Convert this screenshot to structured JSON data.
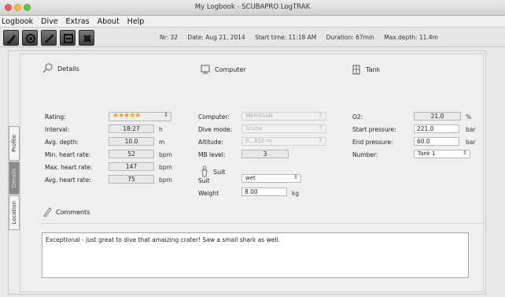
{
  "window": {
    "title": "My Logbook - SCUBAPRO LogTRAK"
  },
  "menu": {
    "items": [
      "Logbook",
      "Dive",
      "Extras",
      "About",
      "Help"
    ]
  },
  "toolbar": {
    "buttons": [
      "logbook-icon",
      "dive-computer-icon",
      "edit-icon",
      "download-icon",
      "settings-icon"
    ],
    "dive_info": {
      "nr": "Nr: 32",
      "date": "Date: Aug 21, 2014",
      "start": "Start time: 11:18 AM",
      "duration": "Duration: 67min",
      "maxdepth": "Max.depth: 11.4m"
    }
  },
  "side_tabs": {
    "profile": "Profile",
    "details": "Details",
    "location": "Location",
    "active": "details"
  },
  "details": {
    "header": "Details",
    "rating_label": "Rating:",
    "rating": {
      "value": 5,
      "max": 5,
      "stars": "★★★★★"
    },
    "interval_label": "Interval:",
    "interval_value": "18:27",
    "interval_unit": "h",
    "avgdepth_label": "Avg. depth:",
    "avgdepth_value": "10.0",
    "avgdepth_unit": "m",
    "minhr_label": "Min. heart rate:",
    "minhr_value": "52",
    "minhr_unit": "bpm",
    "maxhr_label": "Max. heart rate:",
    "maxhr_value": "147",
    "maxhr_unit": "bpm",
    "avghr_label": "Avg. heart rate:",
    "avghr_value": "75",
    "avghr_unit": "bpm"
  },
  "computer": {
    "header": "Computer",
    "computer_label": "Computer:",
    "computer_value": "MERIDIAN",
    "divemode_label": "Dive mode:",
    "divemode_value": "Scuba",
    "altitude_label": "Altitude:",
    "altitude_value": "0...850 m",
    "mb_label": "MB level:",
    "mb_value": "3"
  },
  "suit": {
    "header": "Suit",
    "suit_label": "Suit",
    "suit_value": "wet",
    "weight_label": "Weight",
    "weight_value": "8.00",
    "weight_unit": "kg"
  },
  "tank": {
    "header": "Tank",
    "o2_label": "O2:",
    "o2_value": "21.0",
    "o2_unit": "%",
    "start_label": "Start pressure:",
    "start_value": "221.0",
    "start_unit": "bar",
    "end_label": "End pressure:",
    "end_value": "60.0",
    "end_unit": "bar",
    "number_label": "Number:",
    "number_value": "Tank 1"
  },
  "comments": {
    "header": "Comments",
    "text": "Exceptional - just great to dive that amaizing crater! Saw a small shark as well."
  },
  "colors": {
    "star": "#e0a21b",
    "toolbar_button": "#4a4a4a"
  }
}
